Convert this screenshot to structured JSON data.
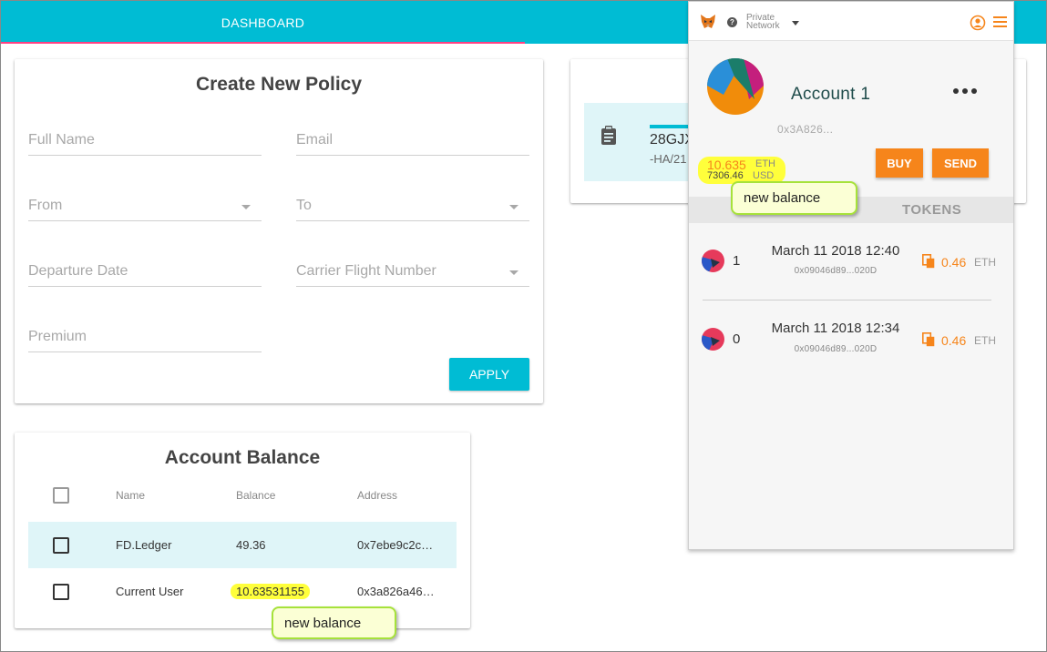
{
  "nav": {
    "tab_dashboard": "DASHBOARD"
  },
  "policy_form": {
    "title": "Create New Policy",
    "full_name": "Full Name",
    "email": "Email",
    "from": "From",
    "to": "To",
    "departure_date": "Departure Date",
    "carrier_flight_number": "Carrier Flight Number",
    "premium": "Premium",
    "apply_label": "APPLY"
  },
  "policy_list": {
    "item": {
      "code": "28GJX",
      "sub": "-HA/21"
    }
  },
  "account_balance": {
    "title": "Account Balance",
    "columns": [
      "Name",
      "Balance",
      "Address"
    ],
    "rows": [
      {
        "name": "FD.Ledger",
        "balance": "49.36",
        "address": "0x7ebe9c2c…"
      },
      {
        "name": "Current User",
        "balance": "10.63531155",
        "address": "0x3a826a46…"
      }
    ]
  },
  "callouts": {
    "metamask": "new balance",
    "table": "new balance"
  },
  "metamask": {
    "network_line1": "Private",
    "network_line2": "Network",
    "account_name": "Account 1",
    "address": "0x3A826...",
    "eth_balance": "10.635",
    "eth_unit": "ETH",
    "usd_balance": "7306.46",
    "usd_unit": "USD",
    "buy_label": "BUY",
    "send_label": "SEND",
    "tokens_tab": "TOKENS",
    "transactions": [
      {
        "nonce": "1",
        "date": "March 11 2018 12:40",
        "hash": "0x09046d89...020D",
        "amount": "0.46",
        "unit": "ETH"
      },
      {
        "nonce": "0",
        "date": "March 11 2018 12:34",
        "hash": "0x09046d89...020D",
        "amount": "0.46",
        "unit": "ETH"
      }
    ],
    "colors": {
      "accent": "#f6851b",
      "account_name": "#1e4b4a"
    }
  },
  "colors": {
    "primary": "#00bcd4",
    "tab_indicator": "#ff4081",
    "highlight": "#ffff3b"
  },
  "icons": [
    "metamask-fox-icon",
    "help-icon",
    "account-switch-icon",
    "hamburger-menu-icon",
    "clipboard-icon",
    "copy-icon"
  ]
}
